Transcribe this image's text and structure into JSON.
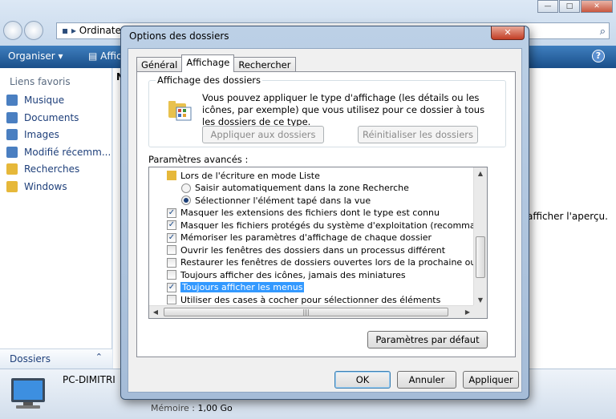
{
  "explorer": {
    "address_text": "Ordinate",
    "toolbar": {
      "organize": "Organiser",
      "display": "Affic"
    },
    "favorites_header": "Liens favoris",
    "favorites": [
      {
        "label": "Musique",
        "icon": "music-folder-icon",
        "color": "#4a7fc1"
      },
      {
        "label": "Documents",
        "icon": "documents-folder-icon",
        "color": "#4a7fc1"
      },
      {
        "label": "Images",
        "icon": "images-folder-icon",
        "color": "#4a7fc1"
      },
      {
        "label": "Modifié récemm...",
        "icon": "recent-folder-icon",
        "color": "#4a7fc1"
      },
      {
        "label": "Recherches",
        "icon": "search-folder-icon",
        "color": "#e6b83a"
      },
      {
        "label": "Windows",
        "icon": "folder-icon",
        "color": "#e6b83a"
      }
    ],
    "folders_label": "Dossiers",
    "column_header": "N",
    "preview_text": "afficher l'aperçu.",
    "computer_name": "PC-DIMITRI",
    "memory_label": "Mémoire :",
    "memory_value": "1,00 Go"
  },
  "dialog": {
    "title": "Options des dossiers",
    "tabs": [
      "Général",
      "Affichage",
      "Rechercher"
    ],
    "active_tab": "Affichage",
    "folder_view": {
      "group_title": "Affichage des dossiers",
      "description": "Vous pouvez appliquer le type d'affichage (les détails ou les icônes, par exemple) que vous utilisez pour ce dossier à tous les dossiers de ce type.",
      "apply_button": "Appliquer aux dossiers",
      "reset_button": "Réinitialiser les dossiers"
    },
    "advanced_label": "Paramètres avancés :",
    "settings": [
      {
        "type": "folder",
        "label": "Lors de l'écriture en mode Liste",
        "indent": 1
      },
      {
        "type": "radio",
        "label": "Saisir automatiquement dans la zone Recherche",
        "checked": false,
        "indent": 2
      },
      {
        "type": "radio",
        "label": "Sélectionner l'élément tapé dans la vue",
        "checked": true,
        "indent": 2
      },
      {
        "type": "check",
        "label": "Masquer les extensions des fichiers dont le type est connu",
        "checked": true,
        "indent": 1
      },
      {
        "type": "check",
        "label": "Masquer les fichiers protégés du système d'exploitation (recommandé)",
        "checked": true,
        "indent": 1
      },
      {
        "type": "check",
        "label": "Mémoriser les paramètres d'affichage de chaque dossier",
        "checked": true,
        "indent": 1
      },
      {
        "type": "check",
        "label": "Ouvrir les fenêtres des dossiers dans un processus différent",
        "checked": false,
        "indent": 1
      },
      {
        "type": "check",
        "label": "Restaurer les fenêtres de dossiers ouvertes lors de la prochaine ouverture de ses",
        "checked": false,
        "indent": 1
      },
      {
        "type": "check",
        "label": "Toujours afficher des icônes, jamais des miniatures",
        "checked": false,
        "indent": 1
      },
      {
        "type": "check",
        "label": "Toujours afficher les menus",
        "checked": true,
        "indent": 1,
        "selected": true
      },
      {
        "type": "check",
        "label": "Utiliser des cases à cocher pour sélectionner des éléments",
        "checked": false,
        "indent": 1
      }
    ],
    "defaults_button": "Paramètres par défaut",
    "ok_button": "OK",
    "cancel_button": "Annuler",
    "apply_button": "Appliquer"
  }
}
